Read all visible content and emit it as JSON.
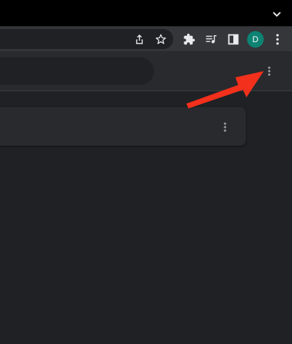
{
  "profile": {
    "avatar_initial": "D",
    "avatar_color": "#0d8373"
  },
  "icons": {
    "tab_search": "chevron-down-icon",
    "share": "share-icon",
    "bookmark": "star-icon",
    "extensions": "puzzle-icon",
    "media": "media-queue-icon",
    "side_panel": "side-panel-icon",
    "browser_menu": "more-vert-icon",
    "page_menu": "more-vert-icon",
    "card_menu": "more-vert-icon"
  },
  "annotation": {
    "arrow_color": "#f2301c"
  },
  "colors": {
    "tabstrip": "#000000",
    "toolbar": "#35363a",
    "page_bg": "#202124",
    "header_bg": "#292a2d",
    "icon": "#e8eaed"
  }
}
